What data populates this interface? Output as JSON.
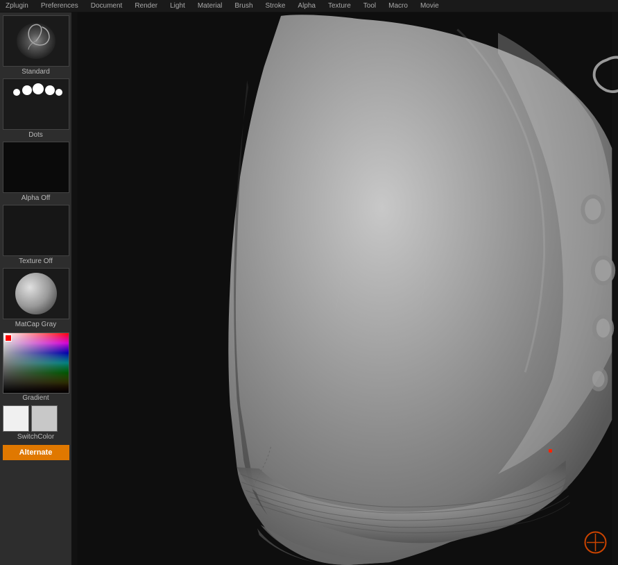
{
  "topbar": {
    "menu_items": [
      "Zplugin",
      "Preferences",
      "Document",
      "Render",
      "Light",
      "Material",
      "Brush",
      "Stroke",
      "Alpha",
      "Texture",
      "Tool",
      "Macro",
      "Movie"
    ]
  },
  "sidebar": {
    "standard_label": "Standard",
    "dots_label": "Dots",
    "alpha_off_label": "Alpha Off",
    "texture_off_label": "Texture Off",
    "matcap_label": "MatCap Gray",
    "gradient_label": "Gradient",
    "switch_color_label": "SwitchColor",
    "alternate_label": "Alternate"
  },
  "viewport": {
    "background": "#111111"
  }
}
